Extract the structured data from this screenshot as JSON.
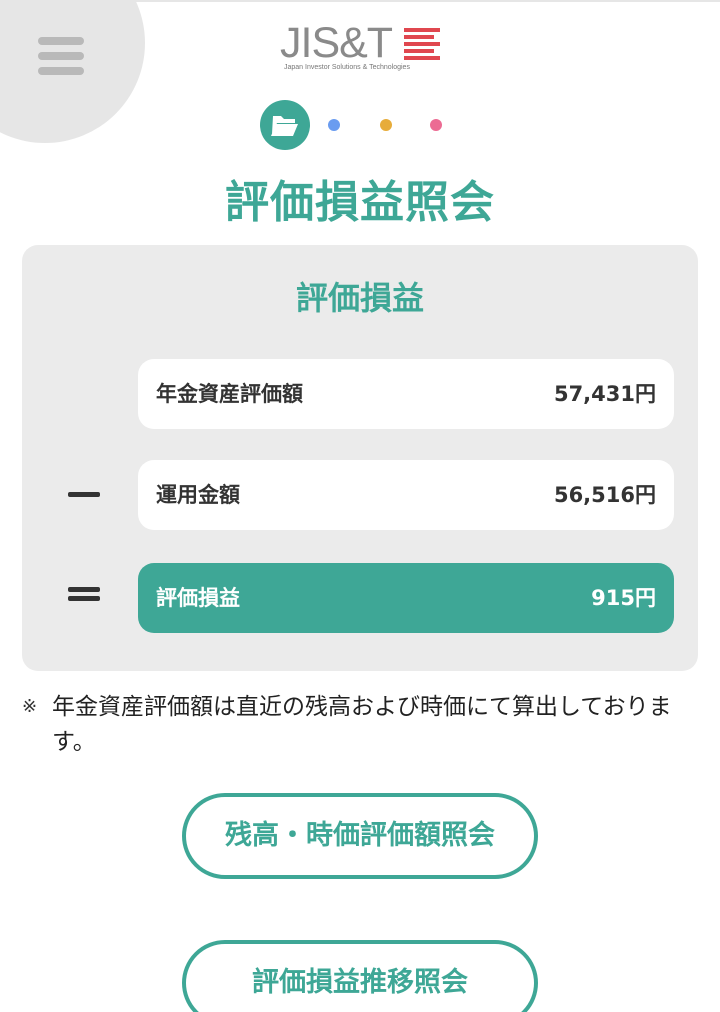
{
  "header": {
    "menu_icon": "hamburger-menu-icon",
    "logo": {
      "text": "JIS&T",
      "subtitle": "Japan Investor Solutions & Technologies"
    },
    "steps": {
      "active_icon": "folder-open-icon",
      "colors": {
        "active": "#3ea796",
        "dot1": "#6a9cf0",
        "dot2": "#e7ac3a",
        "dot3": "#ec6b93"
      }
    }
  },
  "page_title": "評価損益照会",
  "summary": {
    "title": "評価損益",
    "rows": [
      {
        "label": "年金資産評価額",
        "value": "57,431円"
      },
      {
        "label": "運用金額",
        "value": "56,516円"
      },
      {
        "label": "評価損益",
        "value": "915円"
      }
    ]
  },
  "note": {
    "mark": "※",
    "text": "年金資産評価額は直近の残高および時価にて算出しております。"
  },
  "buttons": {
    "balance_inquiry": "残高・時価評価額照会",
    "history_inquiry": "評価損益推移照会"
  },
  "colors": {
    "accent": "#3ea796",
    "panel": "#ebebeb",
    "text": "#333333"
  }
}
